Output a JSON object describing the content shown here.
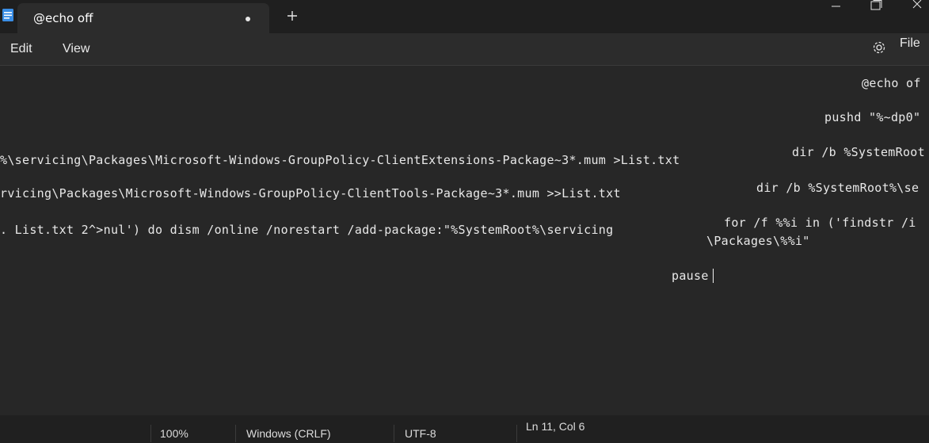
{
  "tab": {
    "title": "@echo off"
  },
  "window_controls": [
    "minimize-icon",
    "maximize-icon",
    "close-icon"
  ],
  "menu": {
    "edit": "Edit",
    "view": "View",
    "file": "File"
  },
  "editor": {
    "lines": [
      "@echo off",
      "pushd \"%~dp0\"",
      "dir /b %SystemRoot%\\servicing\\Packages\\Microsoft-Windows-GroupPolicy-ClientExtensions-Package~3*.mum >List.txt",
      "dir /b %SystemRoot%\\servicing\\Packages\\Microsoft-Windows-GroupPolicy-ClientTools-Package~3*.mum >>List.txt",
      "for /f %%i in ('findstr /i . List.txt 2^>nul') do dism /online /norestart /add-package:\"%SystemRoot%\\servicing",
      "\\Packages\\%%i\"",
      "pause"
    ],
    "visible_fragments": {
      "line1_right": "@echo of",
      "line2_right": "pushd \"%~dp0\"",
      "line3_right": "dir /b %SystemRoot",
      "line3_left": "%\\servicing\\Packages\\Microsoft-Windows-GroupPolicy-ClientExtensions-Package~3*.mum >List.txt",
      "line4_right": "dir /b %SystemRoot%\\se",
      "line4_left": "rvicing\\Packages\\Microsoft-Windows-GroupPolicy-ClientTools-Package~3*.mum >>List.txt",
      "line5_right": "for /f %%i in ('findstr /i",
      "line5_left": ". List.txt 2^>nul') do dism /online /norestart /add-package:\"%SystemRoot%\\servicing",
      "line6_right": "\\Packages\\%%i\"",
      "line7_right": "pause"
    }
  },
  "status": {
    "position": "Ln 11, Col 6",
    "zoom": "100%",
    "line_ending": "Windows (CRLF)",
    "encoding": "UTF-8"
  },
  "colors": {
    "background": "#272727",
    "titlebar": "#1f1f1f",
    "menubar": "#2c2c2c",
    "statusbar": "#202020",
    "text": "#e8e8e8"
  }
}
